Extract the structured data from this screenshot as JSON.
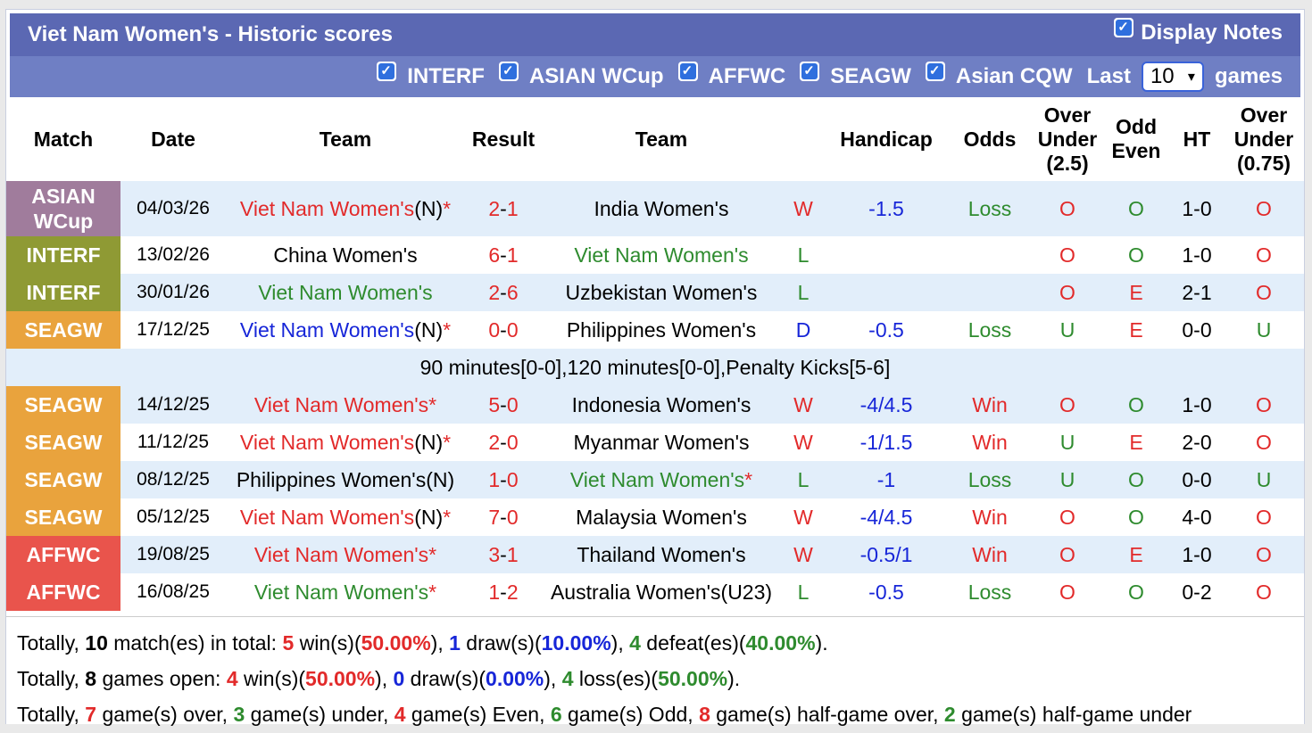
{
  "title": "Viet Nam Women's - Historic scores",
  "display_notes": "Display Notes",
  "filters": [
    "INTERF",
    "ASIAN WCup",
    "AFFWC",
    "SEAGW",
    "Asian CQW"
  ],
  "last_label": "Last",
  "last_value": "10",
  "games_label": "games",
  "headers": {
    "match": "Match",
    "date": "Date",
    "team1": "Team",
    "result": "Result",
    "team2": "Team",
    "handicap": "Handicap",
    "odds": "Odds",
    "ou25_line1": "Over",
    "ou25_line2": "Under",
    "ou25_line3": "(2.5)",
    "oe_line1": "Odd",
    "oe_line2": "Even",
    "ht": "HT",
    "ou075_line1": "Over",
    "ou075_line2": "Under",
    "ou075_line3": "(0.75)"
  },
  "colors": {
    "ASIAN WCup": "#a07c9c",
    "INTERF": "#8f9a34",
    "SEAGW": "#e9a33d",
    "AFFWC": "#e9544c"
  },
  "rows": [
    {
      "league": "ASIAN WCup",
      "league_l1": "ASIAN",
      "league_l2": "WCup",
      "date": "04/03/26",
      "team1": "Viet Nam Women's",
      "team1_suffix": "(N)",
      "team1_star": "*",
      "team1_color": "red",
      "score1": "2",
      "score2": "1",
      "team2": "India Women's",
      "team2_star": "",
      "team2_color": "black",
      "res": "W",
      "hcp": "-1.5",
      "odds": "Loss",
      "ou": "O",
      "oe": "O",
      "ht": "1-0",
      "ou2": "O"
    },
    {
      "league": "INTERF",
      "date": "13/02/26",
      "team1": "China Women's",
      "team1_suffix": "",
      "team1_star": "",
      "team1_color": "black",
      "score1": "6",
      "score2": "1",
      "team2": "Viet Nam Women's",
      "team2_star": "",
      "team2_color": "green",
      "res": "L",
      "hcp": "",
      "odds": "",
      "ou": "O",
      "oe": "O",
      "ht": "1-0",
      "ou2": "O"
    },
    {
      "league": "INTERF",
      "date": "30/01/26",
      "team1": "Viet Nam Women's",
      "team1_suffix": "",
      "team1_star": "",
      "team1_color": "green",
      "score1": "2",
      "score2": "6",
      "team2": "Uzbekistan Women's",
      "team2_star": "",
      "team2_color": "black",
      "res": "L",
      "hcp": "",
      "odds": "",
      "ou": "O",
      "oe": "E",
      "ht": "2-1",
      "ou2": "O"
    },
    {
      "league": "SEAGW",
      "date": "17/12/25",
      "team1": "Viet Nam Women's",
      "team1_suffix": "(N)",
      "team1_star": "*",
      "team1_color": "blue",
      "score1": "0",
      "score2": "0",
      "team2": "Philippines Women's",
      "team2_star": "",
      "team2_color": "black",
      "res": "D",
      "hcp": "-0.5",
      "odds": "Loss",
      "ou": "U",
      "oe": "E",
      "ht": "0-0",
      "ou2": "U"
    },
    {
      "note": "90 minutes[0-0],120 minutes[0-0],Penalty Kicks[5-6]"
    },
    {
      "league": "SEAGW",
      "date": "14/12/25",
      "team1": "Viet Nam Women's",
      "team1_suffix": "",
      "team1_star": "*",
      "team1_color": "red",
      "score1": "5",
      "score2": "0",
      "team2": "Indonesia Women's",
      "team2_star": "",
      "team2_color": "black",
      "res": "W",
      "hcp": "-4/4.5",
      "odds": "Win",
      "ou": "O",
      "oe": "O",
      "ht": "1-0",
      "ou2": "O"
    },
    {
      "league": "SEAGW",
      "date": "11/12/25",
      "team1": "Viet Nam Women's",
      "team1_suffix": "(N)",
      "team1_star": "*",
      "team1_color": "red",
      "score1": "2",
      "score2": "0",
      "team2": "Myanmar Women's",
      "team2_star": "",
      "team2_color": "black",
      "res": "W",
      "hcp": "-1/1.5",
      "odds": "Win",
      "ou": "U",
      "oe": "E",
      "ht": "2-0",
      "ou2": "O"
    },
    {
      "league": "SEAGW",
      "date": "08/12/25",
      "team1": "Philippines Women's",
      "team1_suffix": "(N)",
      "team1_star": "",
      "team1_color": "black",
      "score1": "1",
      "score2": "0",
      "team2": "Viet Nam Women's",
      "team2_star": "*",
      "team2_color": "green",
      "res": "L",
      "hcp": "-1",
      "odds": "Loss",
      "ou": "U",
      "oe": "O",
      "ht": "0-0",
      "ou2": "U"
    },
    {
      "league": "SEAGW",
      "date": "05/12/25",
      "team1": "Viet Nam Women's",
      "team1_suffix": "(N)",
      "team1_star": "*",
      "team1_color": "red",
      "score1": "7",
      "score2": "0",
      "team2": "Malaysia Women's",
      "team2_star": "",
      "team2_color": "black",
      "res": "W",
      "hcp": "-4/4.5",
      "odds": "Win",
      "ou": "O",
      "oe": "O",
      "ht": "4-0",
      "ou2": "O"
    },
    {
      "league": "AFFWC",
      "date": "19/08/25",
      "team1": "Viet Nam Women's",
      "team1_suffix": "",
      "team1_star": "*",
      "team1_color": "red",
      "score1": "3",
      "score2": "1",
      "team2": "Thailand Women's",
      "team2_star": "",
      "team2_color": "black",
      "res": "W",
      "hcp": "-0.5/1",
      "odds": "Win",
      "ou": "O",
      "oe": "E",
      "ht": "1-0",
      "ou2": "O"
    },
    {
      "league": "AFFWC",
      "date": "16/08/25",
      "team1": "Viet Nam Women's",
      "team1_suffix": "",
      "team1_star": "*",
      "team1_color": "green",
      "score1": "1",
      "score2": "2",
      "team2": "Australia Women's(U23)",
      "team2_star": "",
      "team2_color": "black",
      "res": "L",
      "hcp": "-0.5",
      "odds": "Loss",
      "ou": "O",
      "oe": "O",
      "ht": "0-2",
      "ou2": "O"
    }
  ],
  "summary": {
    "line1": {
      "p1": "Totally, ",
      "n_total": "10",
      "p2": " match(es) in total: ",
      "wins": "5",
      "p3": " win(s)(",
      "win_pct": "50.00%",
      "p4": "), ",
      "draws": "1",
      "p5": " draw(s)(",
      "draw_pct": "10.00%",
      "p6": "), ",
      "defeats": "4",
      "p7": " defeat(es)(",
      "defeat_pct": "40.00%",
      "p8": ")."
    },
    "line2": {
      "p1": "Totally, ",
      "n_open": "8",
      "p2": " games open: ",
      "wins": "4",
      "p3": " win(s)(",
      "win_pct": "50.00%",
      "p4": "), ",
      "draws": "0",
      "p5": " draw(s)(",
      "draw_pct": "0.00%",
      "p6": "), ",
      "losses": "4",
      "p7": " loss(es)(",
      "loss_pct": "50.00%",
      "p8": ")."
    },
    "line3": {
      "p1": "Totally, ",
      "over": "7",
      "p2": " game(s) over, ",
      "under": "3",
      "p3": " game(s) under, ",
      "even": "4",
      "p4": " game(s) Even, ",
      "odd": "6",
      "p5": " game(s) Odd, ",
      "hg_over": "8",
      "p6": " game(s) half-game over, ",
      "hg_under": "2",
      "p7": " game(s) half-game under"
    }
  }
}
